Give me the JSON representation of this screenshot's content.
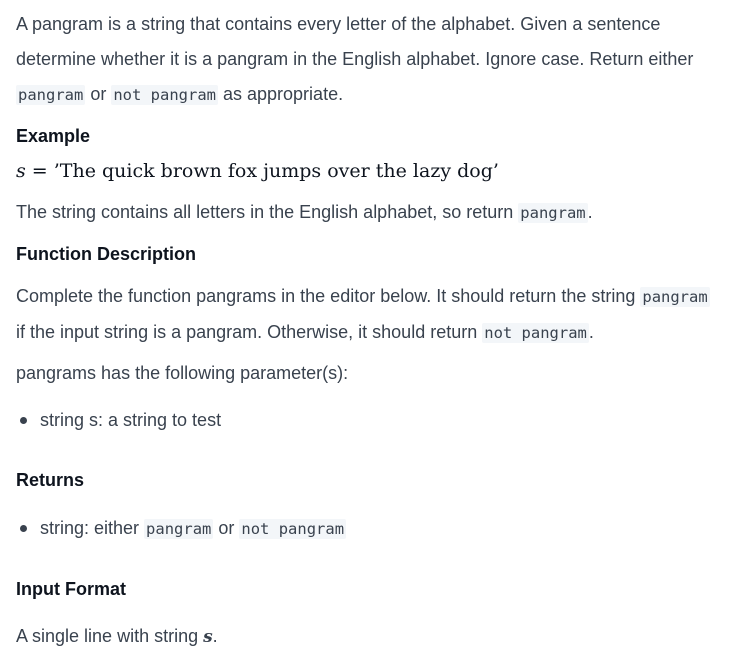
{
  "intro": {
    "text1": "A pangram is a string that contains every letter of the alphabet. Given a sentence determine whether it is a pangram in the English alphabet. Ignore case. Return either ",
    "code1": "pangram",
    "text2": " or ",
    "code2": "not pangram",
    "text3": " as appropriate."
  },
  "example": {
    "heading": "Example",
    "var": "s",
    "equals": " = ",
    "value": "’The quick brown fox jumps over the lazy dog’",
    "explain_text": "The string contains all letters in the English alphabet, so return ",
    "explain_code": "pangram",
    "explain_end": "."
  },
  "function_description": {
    "heading": "Function Description",
    "text1": "Complete the function pangrams in the editor below. It should return the string ",
    "code1": "pangram",
    "text2": " if the input string is a pangram. Otherwise, it should return ",
    "code2": "not pangram",
    "text3": ".",
    "params_intro": "pangrams has the following parameter(s):",
    "params": [
      {
        "text": "string s: a string to test"
      }
    ]
  },
  "returns": {
    "heading": "Returns",
    "item_text": "string: either ",
    "item_code1": "pangram",
    "item_mid": " or ",
    "item_code2": "not pangram"
  },
  "input_format": {
    "heading": "Input Format",
    "text": "A single line with string ",
    "var": "s",
    "end": "."
  }
}
